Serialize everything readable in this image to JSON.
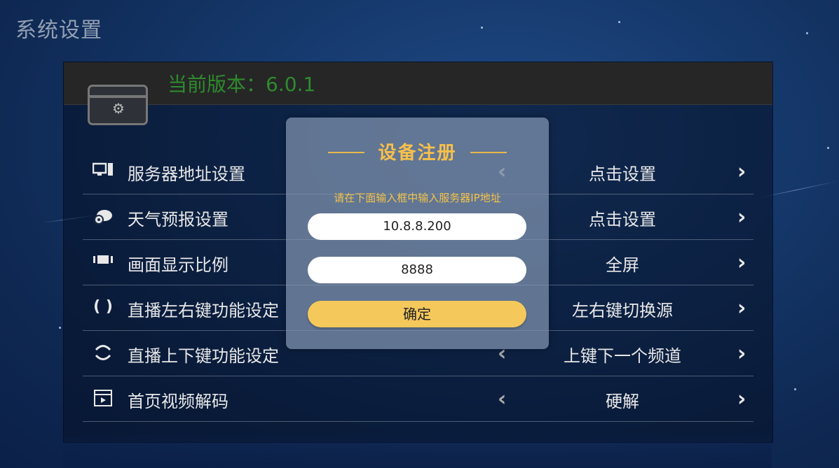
{
  "page": {
    "title": "系统设置"
  },
  "header": {
    "version": "当前版本：6.0.1"
  },
  "rows": [
    {
      "icon": "monitor-icon",
      "label": "服务器地址设置",
      "value": "点击设置"
    },
    {
      "icon": "weather-cloud-gear-icon",
      "label": "天气预报设置",
      "value": "点击设置"
    },
    {
      "icon": "aspect-ratio-icon",
      "label": "画面显示比例",
      "value": "全屏"
    },
    {
      "icon": "left-right-keys-icon",
      "label": "直播左右键功能设定",
      "value": "左右键切换源"
    },
    {
      "icon": "up-down-keys-icon",
      "label": "直播上下键功能设定",
      "value": "上键下一个频道"
    },
    {
      "icon": "video-decode-icon",
      "label": "首页视频解码",
      "value": "硬解"
    }
  ],
  "dialog": {
    "title": "设备注册",
    "hint": "请在下面输入框中输入服务器IP地址",
    "ip_value": "10.8.8.200",
    "port_value": "8888",
    "confirm_label": "确定"
  },
  "colors": {
    "accent": "#f5c85c",
    "title_gold": "#f7c04a",
    "version_green": "#2e8b2e",
    "background": "#163a6e"
  }
}
